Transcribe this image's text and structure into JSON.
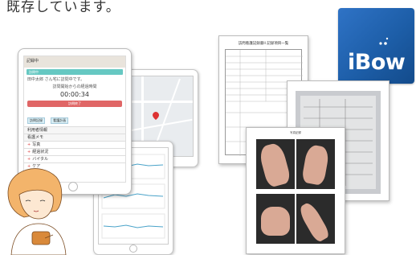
{
  "header": {
    "top_text": "既存しています。"
  },
  "logo": {
    "text": "iBow",
    "bg_color": "#1d5ea8"
  },
  "tablet_main": {
    "header_label": "記録中",
    "status_label": "訪問中",
    "patient_line": "田中太郎 さん宅に訪問中です。",
    "elapsed_label": "訪問開始からの経過時間",
    "timer": "00:00:34",
    "end_button": "訪問終了",
    "chips": [
      "訪問記録",
      "看護計画"
    ],
    "sections": [
      "利用者情報",
      "看護メモ"
    ],
    "items": [
      "写真",
      "経過状況",
      "バイタル",
      "ケア"
    ]
  },
  "documents": {
    "report_title": "訪問看護記録書II 記録項目一覧",
    "photo_sheet_title": "写真記録"
  }
}
